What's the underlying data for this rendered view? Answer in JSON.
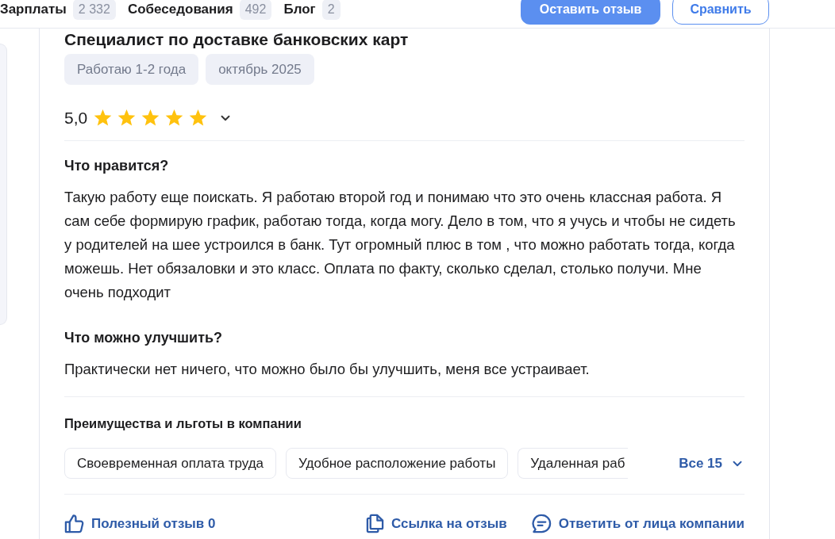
{
  "header": {
    "tabs": [
      {
        "label": "Зарплаты",
        "count": "2 332"
      },
      {
        "label": "Собеседования",
        "count": "492"
      },
      {
        "label": "Блог",
        "count": "2"
      }
    ],
    "buttons": [
      {
        "label": "Оставить отзыв",
        "kind": "primary"
      },
      {
        "label": "Сравнить",
        "kind": "secondary"
      }
    ]
  },
  "review": {
    "position": "Специалист по доставке банковских карт",
    "tags": [
      "Работаю 1-2 года",
      "октябрь 2025"
    ],
    "rating": "5,0",
    "stars": 5,
    "sections": [
      {
        "heading": "Что нравится?",
        "text": "Такую работу еще поискать. Я работаю второй год и понимаю что это очень классная работа. Я сам себе формирую график, работаю тогда, когда могу. Дело в том, что я учусь и чтобы не сидеть у родителей на шее устроился в банк. Тут огромный плюс в том , что можно работать тогда, когда можешь. Нет обязаловки и это класс. Оплата по факту, сколько сделал, столько получи. Мне очень подходит"
      },
      {
        "heading": "Что можно улучшить?",
        "text": "Практически нет ничего, что можно было бы улучшить, меня все устраивает."
      }
    ],
    "benefits": {
      "title": "Преимущества и льготы в компании",
      "items": [
        "Своевременная оплата труда",
        "Удобное расположение работы",
        "Удаленная раб"
      ],
      "more": "Все 15"
    },
    "actions": [
      {
        "kind": "like",
        "label": "Полезный отзыв 0"
      },
      {
        "kind": "link",
        "label": "Ссылка на отзыв"
      },
      {
        "kind": "reply",
        "label": "Ответить от лица компании"
      }
    ]
  }
}
